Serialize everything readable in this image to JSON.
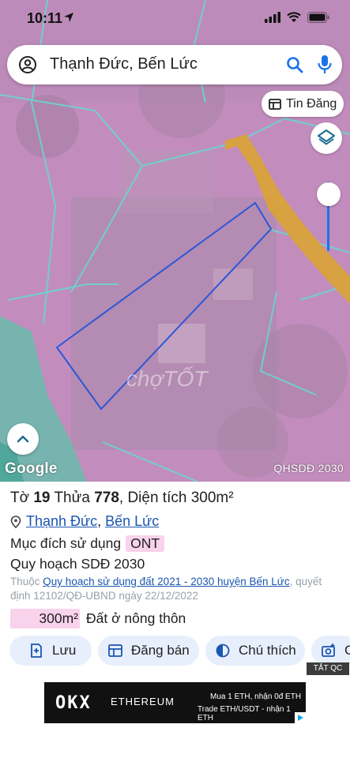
{
  "status_bar": {
    "time": "10:11"
  },
  "search": {
    "value": "Thạnh Đức, Bến Lức"
  },
  "map": {
    "tin_dang_label": "Tin Đăng",
    "google_label": "Google",
    "layer_label": "QHSDĐ 2030",
    "watermark": "chợTỐT"
  },
  "parcel": {
    "to_label": "Tờ",
    "to_value": "19",
    "thua_label": "Thửa",
    "thua_value": "778",
    "area_label": ", Diện tích 300m²",
    "ward": "Thạnh Đức",
    "district": "Bến Lức",
    "purpose_label": "Mục đích sử dụng",
    "purpose_code": "ONT",
    "plan_title": "Quy hoạch SDĐ 2030",
    "note_prefix": "Thuộc",
    "note_link": "Quy hoạch sử dụng đất 2021 - 2030 huyện Bến Lức",
    "note_suffix": ", quyết định 12102/QĐ-UBND ngày 22/12/2022",
    "area_badge": "300m²",
    "area_type": "Đất ở nông thôn"
  },
  "actions": {
    "save": "Lưu",
    "post": "Đăng bán",
    "legend": "Chú thích",
    "more": "C"
  },
  "ad": {
    "close_label": "TẮT QC",
    "brand": "OKX",
    "campaign": "ETHEREUM",
    "line1": "Mua 1 ETH, nhận 0đ ETH",
    "line2": "Trade ETH/USDT - nhận 1 ETH"
  },
  "colors": {
    "map_base": "#c28dbd",
    "road": "#d9a23a",
    "parcel_outline": "#2b57d8",
    "link": "#1a56b0",
    "badge_pink": "#f9d2ec",
    "button_bg": "#e8effc"
  }
}
